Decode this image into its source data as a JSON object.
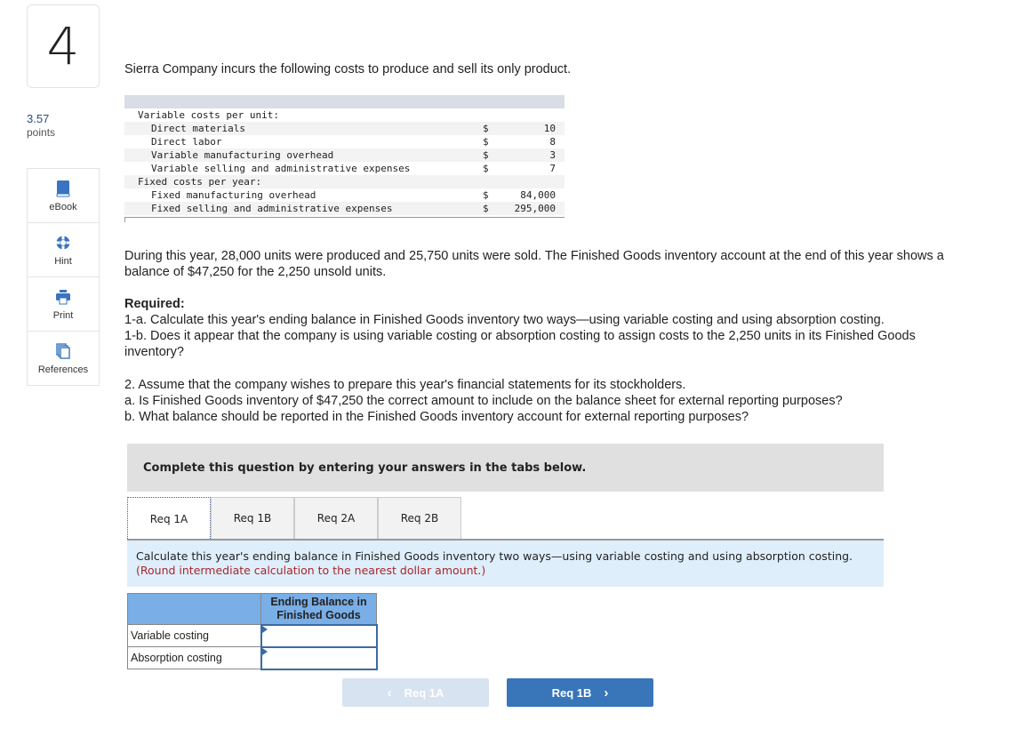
{
  "question": {
    "number": "4",
    "points_value": "3.57",
    "points_label": "points"
  },
  "tools": [
    {
      "label": "eBook",
      "icon": "book-icon"
    },
    {
      "label": "Hint",
      "icon": "lifebuoy-icon"
    },
    {
      "label": "Print",
      "icon": "printer-icon"
    },
    {
      "label": "References",
      "icon": "documents-icon"
    }
  ],
  "intro": "Sierra Company incurs the following costs to produce and sell its only product.",
  "cost_table": {
    "rows": [
      {
        "label": "Variable costs per unit:",
        "indent": false,
        "currency": "",
        "amount": ""
      },
      {
        "label": "Direct materials",
        "indent": true,
        "currency": "$",
        "amount": "10"
      },
      {
        "label": "Direct labor",
        "indent": true,
        "currency": "$",
        "amount": "8"
      },
      {
        "label": "Variable manufacturing overhead",
        "indent": true,
        "currency": "$",
        "amount": "3"
      },
      {
        "label": "Variable selling and administrative expenses",
        "indent": true,
        "currency": "$",
        "amount": "7"
      },
      {
        "label": "Fixed costs per year:",
        "indent": false,
        "currency": "",
        "amount": ""
      },
      {
        "label": "Fixed manufacturing overhead",
        "indent": true,
        "currency": "$",
        "amount": "84,000"
      },
      {
        "label": "Fixed selling and administrative expenses",
        "indent": true,
        "currency": "$",
        "amount": "295,000"
      }
    ]
  },
  "paragraphs": {
    "p1": "During this year, 28,000 units were produced and 25,750 units were sold. The Finished Goods inventory account at the end of this year shows a balance of $47,250 for the 2,250 unsold units.",
    "required_label": "Required:",
    "req_1a": "1-a. Calculate this year's ending balance in Finished Goods inventory two ways—using variable costing and using absorption costing.",
    "req_1b": "1-b. Does it appear that the company is using variable costing or absorption costing to assign costs to the 2,250 units in its Finished Goods inventory?",
    "req_2": "2. Assume that the company wishes to prepare this year's financial statements for its stockholders.",
    "req_2a": "a. Is Finished Goods inventory of $47,250 the correct amount to include on the balance sheet for external reporting purposes?",
    "req_2b": "b. What balance should be reported in the Finished Goods inventory account for external reporting purposes?"
  },
  "instruction": "Complete this question by entering your answers in the tabs below.",
  "tabs": [
    {
      "label": "Req 1A",
      "active": true
    },
    {
      "label": "Req 1B",
      "active": false
    },
    {
      "label": "Req 2A",
      "active": false
    },
    {
      "label": "Req 2B",
      "active": false
    }
  ],
  "tab_panel": {
    "text": "Calculate this year's ending balance in Finished Goods inventory two ways—using variable costing and using absorption costing. ",
    "note": "(Round intermediate calculation to the nearest dollar amount.)"
  },
  "answer_table": {
    "column_header": "Ending Balance in Finished Goods",
    "rows": [
      {
        "label": "Variable costing",
        "value": ""
      },
      {
        "label": "Absorption costing",
        "value": ""
      }
    ]
  },
  "nav": {
    "prev_label": "Req 1A",
    "next_label": "Req 1B",
    "prev_icon": "chevron-left-icon",
    "next_icon": "chevron-right-icon"
  },
  "colors": {
    "accent": "#3875b9",
    "table_header": "#79aee6",
    "panel_bg": "#dfeefb",
    "note_red": "#a8262b"
  }
}
